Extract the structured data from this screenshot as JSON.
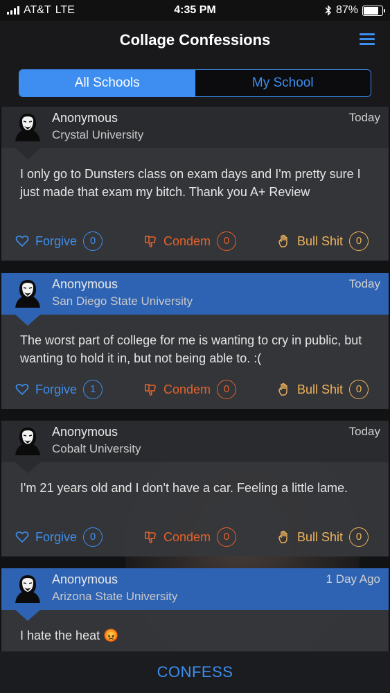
{
  "status": {
    "carrier": "AT&T",
    "network": "LTE",
    "time": "4:35 PM",
    "battery": "87%",
    "battery_level": 0.87
  },
  "header": {
    "title": "Collage Confessions",
    "menu_icon": "hamburger-menu-icon"
  },
  "tabs": {
    "all": "All Schools",
    "mine": "My School",
    "active": "all"
  },
  "actions": {
    "forgive": "Forgive",
    "condemn": "Condem",
    "bull": "Bull Shit"
  },
  "colors": {
    "accent": "#3d8ef0",
    "condemn": "#e4622d",
    "bull": "#f0b35b",
    "highlight": "#2e63b3"
  },
  "posts": [
    {
      "name": "Anonymous",
      "school": "Crystal University",
      "time": "Today",
      "text": "I only go to Dunsters class on exam days and I'm pretty sure I just made that exam my bitch. Thank you A+ Review",
      "forgive": "0",
      "condemn": "0",
      "bull": "0"
    },
    {
      "name": "Anonymous",
      "school": "San Diego State University",
      "time": "Today",
      "text": "The worst part of college for me is wanting to cry in public, but wanting to hold it in, but not being able to. :(",
      "forgive": "1",
      "condemn": "0",
      "bull": "0"
    },
    {
      "name": "Anonymous",
      "school": "Cobalt University",
      "time": "Today",
      "text": "I'm 21 years old and I don't have a car. Feeling a little lame.",
      "forgive": "0",
      "condemn": "0",
      "bull": "0"
    },
    {
      "name": "Anonymous",
      "school": "Arizona State University",
      "time": "1 Day Ago",
      "text": "I hate the heat 😡"
    }
  ],
  "bottom": {
    "confess": "CONFESS"
  }
}
